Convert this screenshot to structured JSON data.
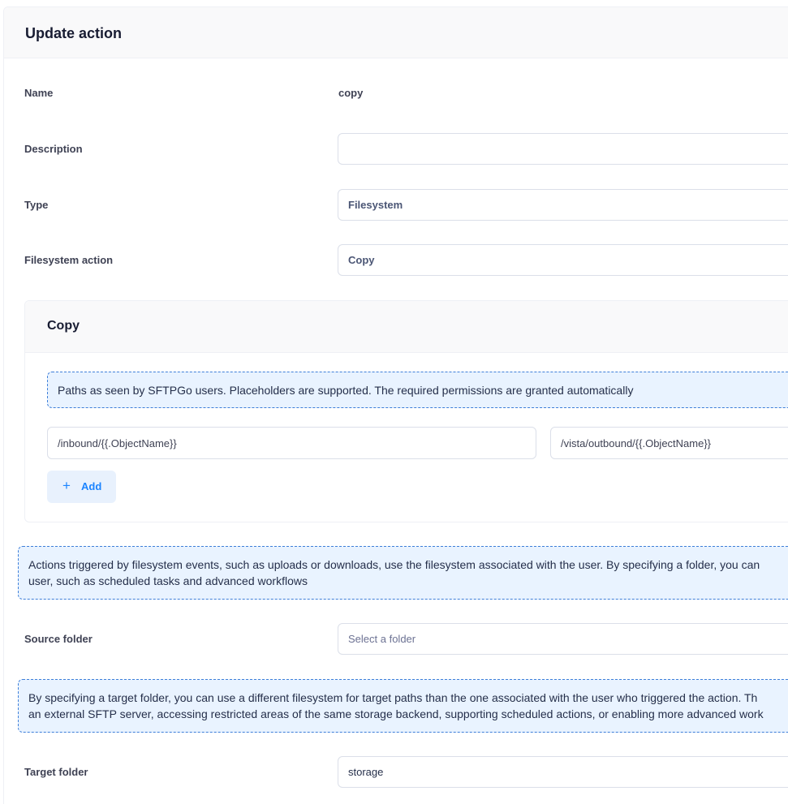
{
  "header": {
    "title": "Update action"
  },
  "form": {
    "name_label": "Name",
    "name_value": "copy",
    "description_label": "Description",
    "description_value": "",
    "type_label": "Type",
    "type_value": "Filesystem",
    "fs_action_label": "Filesystem action",
    "fs_action_value": "Copy",
    "source_folder_label": "Source folder",
    "source_folder_placeholder": "Select a folder",
    "target_folder_label": "Target folder",
    "target_folder_value": "storage"
  },
  "copy_section": {
    "title": "Copy",
    "info": "Paths as seen by SFTPGo users. Placeholders are supported. The required permissions are granted automatically",
    "source_path": "/inbound/{{.ObjectName}}",
    "target_path": "/vista/outbound/{{.ObjectName}}",
    "add_label": "Add",
    "add_icon": "plus-icon"
  },
  "notices": {
    "folder_info_line1": "Actions triggered by filesystem events, such as uploads or downloads, use the filesystem associated with the user. By specifying a folder, you can",
    "folder_info_line2": "user, such as scheduled tasks and advanced workflows",
    "target_info_line1": "By specifying a target folder, you can use a different filesystem for target paths than the one associated with the user who triggered the action. Th",
    "target_info_line2": "an external SFTP server, accessing restricted areas of the same storage backend, supporting scheduled actions, or enabling more advanced work"
  },
  "colors": {
    "primary": "#1b84ff",
    "notice_bg": "#e9f3ff",
    "notice_border": "#3e7fd9"
  }
}
